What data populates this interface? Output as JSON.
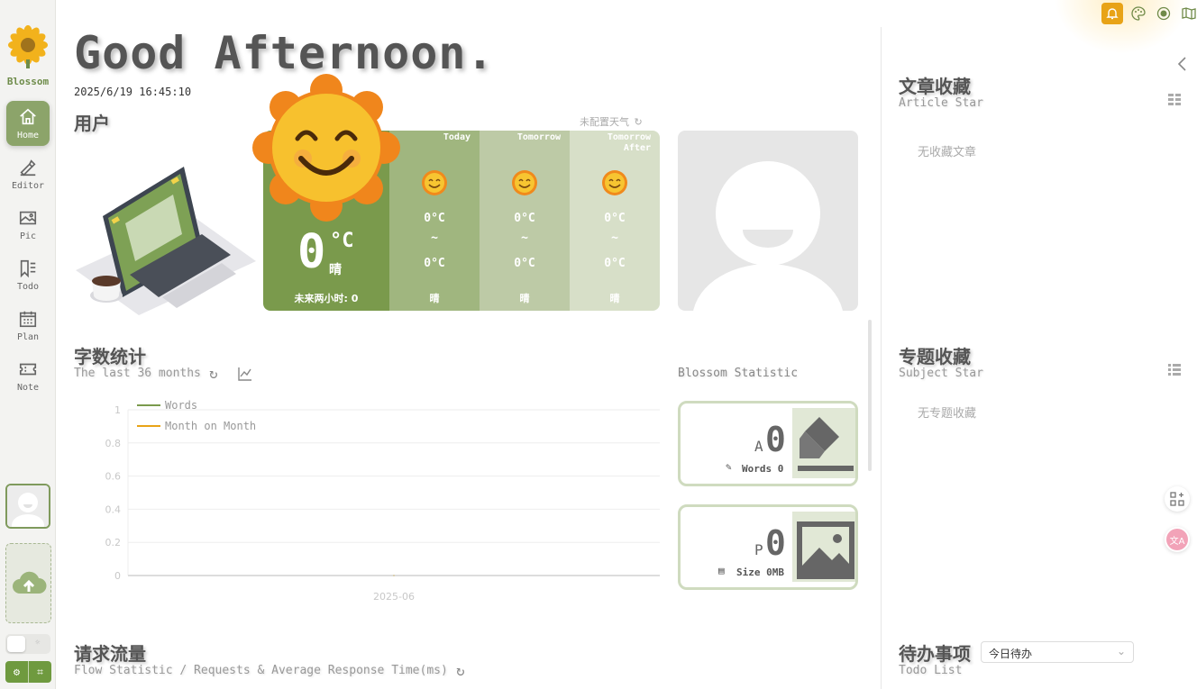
{
  "app": {
    "name": "Blossom"
  },
  "sidebar": {
    "items": [
      {
        "label": "Home",
        "icon": "home-icon",
        "active": true
      },
      {
        "label": "Editor",
        "icon": "pen-icon",
        "active": false
      },
      {
        "label": "Pic",
        "icon": "image-icon",
        "active": false
      },
      {
        "label": "Todo",
        "icon": "bookmark-list-icon",
        "active": false
      },
      {
        "label": "Plan",
        "icon": "calendar-icon",
        "active": false
      },
      {
        "label": "Note",
        "icon": "ticket-icon",
        "active": false
      }
    ]
  },
  "header": {
    "greeting": "Good Afternoon.",
    "datetime": "2025/6/19 16:45:10"
  },
  "user": {
    "title": "用户"
  },
  "weather": {
    "config_text": "未配置天气",
    "now": {
      "temp": "0",
      "unit": "°C",
      "condition": "晴",
      "next_two_hours": "未来两小时: 0"
    },
    "forecast": [
      {
        "day": "Today",
        "high": "0°C",
        "tilde": "~",
        "low": "0°C",
        "condition": "晴"
      },
      {
        "day": "Tomorrow",
        "high": "0°C",
        "tilde": "~",
        "low": "0°C",
        "condition": "晴"
      },
      {
        "day": "Tomorrow After",
        "high": "0°C",
        "tilde": "~",
        "low": "0°C",
        "condition": "晴"
      }
    ]
  },
  "word_stats": {
    "title": "字数统计",
    "subtitle": "The last 36 months"
  },
  "blossom_stats": {
    "title": "Blossom Statistic",
    "words_card": {
      "prefix": "A",
      "value": "0",
      "label": "Words 0"
    },
    "pics_card": {
      "prefix": "P",
      "value": "0",
      "label": "Size 0MB"
    }
  },
  "flow": {
    "title": "请求流量",
    "subtitle": "Flow Statistic / Requests & Average Response Time(ms)"
  },
  "right_panel": {
    "article_star": {
      "title": "文章收藏",
      "subtitle": "Article Star",
      "empty": "无收藏文章"
    },
    "subject_star": {
      "title": "专题收藏",
      "subtitle": "Subject Star",
      "empty": "无专题收藏"
    },
    "todo": {
      "title": "待办事项",
      "subtitle": "Todo List",
      "select_value": "今日待办"
    }
  },
  "colors": {
    "accent": "#7a9a4c",
    "bell": "#e8a317",
    "words_line": "#7a9a4c",
    "mom_line": "#e8a317"
  },
  "chart_data": {
    "type": "line",
    "categories": [
      "2025-06"
    ],
    "series": [
      {
        "name": "Words",
        "values": [
          0
        ]
      },
      {
        "name": "Month on Month",
        "values": [
          0
        ]
      }
    ],
    "ylim": [
      0,
      1
    ],
    "yticks": [
      "0",
      "0.2",
      "0.4",
      "0.6",
      "0.8",
      "1"
    ],
    "legend": "top-left",
    "grid": true
  }
}
